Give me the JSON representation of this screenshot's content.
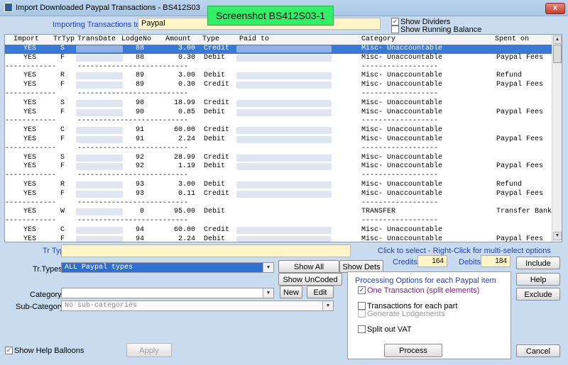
{
  "window": {
    "title": "Import Downloaded Paypal Transactions - BS412S03",
    "badge": "Screenshot BS412S03-1",
    "close": "x"
  },
  "header": {
    "importing_label": "Importing Transactions to",
    "importing_value": "Paypal",
    "show_dividers": {
      "label": "Show Dividers",
      "checked": true
    },
    "show_running_balance": {
      "label": "Show Running Balance",
      "checked": false
    }
  },
  "grid": {
    "columns": [
      "Import",
      "TrTyp",
      "TransDate",
      "LodgeNo",
      "Amount",
      "Type",
      "Paid to",
      "Category",
      "Spent on"
    ],
    "rows": [
      {
        "import": "YES",
        "trtyp": "S",
        "lodge": "88",
        "amount": "3.00",
        "type": "Credit",
        "category": "Misc- Unaccountable",
        "spent": "",
        "selected": true
      },
      {
        "import": "YES",
        "trtyp": "F",
        "lodge": "88",
        "amount": "0.30",
        "type": "Debit",
        "category": "Misc- Unaccountable",
        "spent": "Paypal Fees"
      },
      {
        "divider": true
      },
      {
        "import": "YES",
        "trtyp": "R",
        "lodge": "89",
        "amount": "3.00",
        "type": "Debit",
        "category": "Misc- Unaccountable",
        "spent": "Refund"
      },
      {
        "import": "YES",
        "trtyp": "F",
        "lodge": "89",
        "amount": "0.30",
        "type": "Credit",
        "category": "Misc- Unaccountable",
        "spent": "Paypal Fees"
      },
      {
        "divider": true
      },
      {
        "import": "YES",
        "trtyp": "S",
        "lodge": "90",
        "amount": "18.99",
        "type": "Credit",
        "category": "Misc- Unaccountable",
        "spent": ""
      },
      {
        "import": "YES",
        "trtyp": "F",
        "lodge": "90",
        "amount": "0.85",
        "type": "Debit",
        "category": "Misc- Unaccountable",
        "spent": "Paypal Fees"
      },
      {
        "divider": true
      },
      {
        "import": "YES",
        "trtyp": "C",
        "lodge": "91",
        "amount": "60.00",
        "type": "Credit",
        "category": "Misc- Unaccountable",
        "spent": ""
      },
      {
        "import": "YES",
        "trtyp": "F",
        "lodge": "91",
        "amount": "2.24",
        "type": "Debit",
        "category": "Misc- Unaccountable",
        "spent": "Paypal Fees"
      },
      {
        "divider": true
      },
      {
        "import": "YES",
        "trtyp": "S",
        "lodge": "92",
        "amount": "28.99",
        "type": "Credit",
        "category": "Misc- Unaccountable",
        "spent": ""
      },
      {
        "import": "YES",
        "trtyp": "F",
        "lodge": "92",
        "amount": "1.19",
        "type": "Debit",
        "category": "Misc- Unaccountable",
        "spent": "Paypal Fees"
      },
      {
        "divider": true
      },
      {
        "import": "YES",
        "trtyp": "R",
        "lodge": "93",
        "amount": "3.00",
        "type": "Debit",
        "category": "Misc- Unaccountable",
        "spent": "Refund"
      },
      {
        "import": "YES",
        "trtyp": "F",
        "lodge": "93",
        "amount": "0.11",
        "type": "Credit",
        "category": "Misc- Unaccountable",
        "spent": "Paypal Fees"
      },
      {
        "divider": true
      },
      {
        "import": "YES",
        "trtyp": "W",
        "lodge": "0",
        "amount": "95.00",
        "type": "Debit",
        "category": "TRANSFER",
        "spent": "Transfer Bank",
        "noblur": true
      },
      {
        "divider": true
      },
      {
        "import": "YES",
        "trtyp": "C",
        "lodge": "94",
        "amount": "60.00",
        "type": "Credit",
        "category": "Misc- Unaccountable",
        "spent": ""
      },
      {
        "import": "YES",
        "trtyp": "F",
        "lodge": "94",
        "amount": "2.24",
        "type": "Debit",
        "category": "Misc- Unaccountable",
        "spent": "Paypal Fees"
      }
    ]
  },
  "bottom": {
    "tr_type_label": "Tr Type",
    "hint": "Click to select  -  Right-Click for multi-select options",
    "credits_label": "Credits",
    "credits_value": "164",
    "debits_label": "Debits",
    "debits_value": "184",
    "trtypes_label": "Tr.Types",
    "trtypes_value": "ALL Paypal types",
    "show_all": "Show All",
    "show_dets": "Show Dets",
    "show_uncoded": "Show UnCoded",
    "category_label": "Category",
    "subcategory_label": "Sub-Category",
    "subcategory_value": "No sub-categories",
    "new": "New",
    "edit": "Edit",
    "include": "Include",
    "help": "Help",
    "exclude": "Exclude",
    "cancel": "Cancel",
    "apply": "Apply",
    "show_help_balloons": {
      "label": "Show Help Balloons",
      "checked": true
    }
  },
  "options": {
    "title": "Processing Options for each Paypal  item",
    "one_transaction": {
      "label": "One Transaction (split elements)",
      "checked": true
    },
    "transactions_each_part": {
      "label": "Transactions for each part",
      "checked": false
    },
    "generate_lodgements": {
      "label": "Generate Lodgements",
      "checked": false
    },
    "split_vat": {
      "label": "Split out VAT",
      "checked": false
    },
    "process": "Process"
  }
}
